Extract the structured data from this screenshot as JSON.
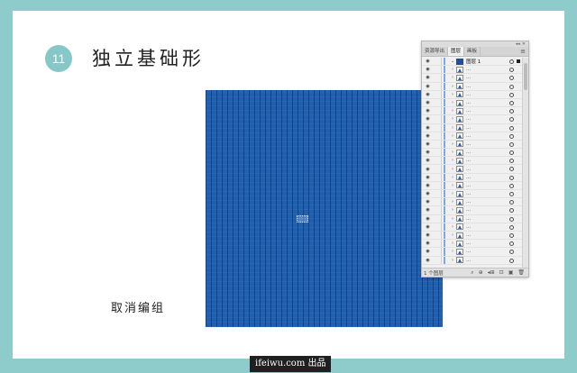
{
  "slide": {
    "step_number": "11",
    "title": "独立基础形",
    "caption": "取消编组"
  },
  "colors": {
    "frame": "#8ecccc",
    "badge": "#86c8c8",
    "canvas_blue": "#1f5fae",
    "panel_bg": "#f0f0f0"
  },
  "layers_panel": {
    "tabs": [
      {
        "label": "资源导出",
        "active": false
      },
      {
        "label": "图层",
        "active": true
      },
      {
        "label": "画板",
        "active": false
      }
    ],
    "top_controls": [
      "◂◂",
      "✕"
    ],
    "menu_icon": "≡",
    "top_layer": {
      "name": "图层 1",
      "expanded": true
    },
    "sublayer_label": "...",
    "sublayer_count": 24,
    "status_text": "1 个图层",
    "bottom_icons": [
      "⌕",
      "⊕",
      "◂⊞",
      "⊡",
      "▣",
      "🗑"
    ]
  },
  "footer": {
    "site": "ifeiwu.com 出品"
  }
}
